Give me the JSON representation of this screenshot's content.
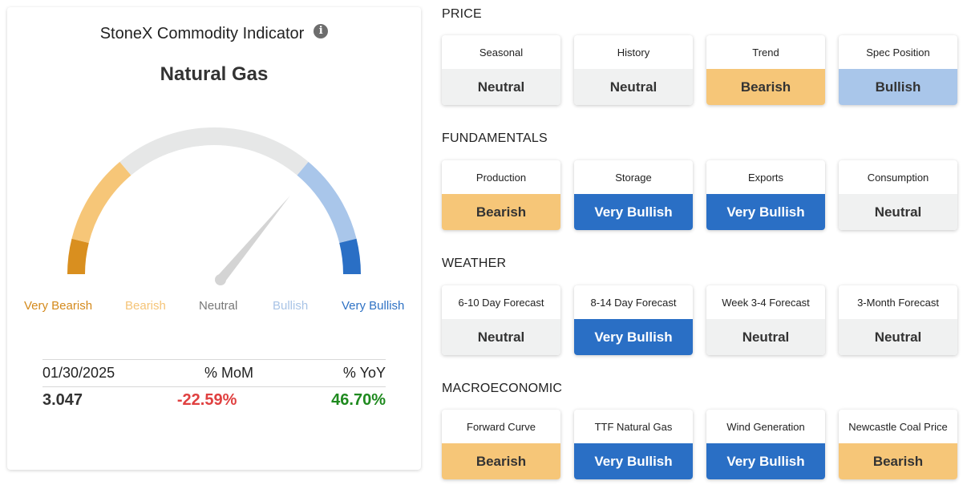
{
  "indicator": {
    "title": "StoneX Commodity Indicator",
    "info_icon": "info-icon",
    "commodity": "Natural Gas",
    "gauge_level": 0.72,
    "gauge_colors": {
      "very_bearish": "#d98f1f",
      "bearish": "#f6c678",
      "neutral": "#e6e7e7",
      "bullish": "#a9c6ea",
      "very_bullish": "#2a6fc5"
    },
    "scale_labels": [
      "Very Bearish",
      "Bearish",
      "Neutral",
      "Bullish",
      "Very Bullish"
    ],
    "stats": {
      "date": "01/30/2025",
      "mom_header": "% MoM",
      "yoy_header": "% YoY",
      "price": "3.047",
      "mom": "-22.59%",
      "yoy": "46.70%"
    }
  },
  "sections": [
    {
      "title": "PRICE",
      "cards": [
        {
          "label": "Seasonal",
          "value": "Neutral",
          "status": "neutral"
        },
        {
          "label": "History",
          "value": "Neutral",
          "status": "neutral"
        },
        {
          "label": "Trend",
          "value": "Bearish",
          "status": "bearish"
        },
        {
          "label": "Spec Position",
          "value": "Bullish",
          "status": "bullish"
        }
      ]
    },
    {
      "title": "FUNDAMENTALS",
      "cards": [
        {
          "label": "Production",
          "value": "Bearish",
          "status": "bearish"
        },
        {
          "label": "Storage",
          "value": "Very Bullish",
          "status": "verybullish"
        },
        {
          "label": "Exports",
          "value": "Very Bullish",
          "status": "verybullish"
        },
        {
          "label": "Consumption",
          "value": "Neutral",
          "status": "neutral"
        }
      ]
    },
    {
      "title": "WEATHER",
      "cards": [
        {
          "label": "6-10 Day Forecast",
          "value": "Neutral",
          "status": "neutral"
        },
        {
          "label": "8-14 Day Forecast",
          "value": "Very Bullish",
          "status": "verybullish"
        },
        {
          "label": "Week 3-4 Forecast",
          "value": "Neutral",
          "status": "neutral"
        },
        {
          "label": "3-Month Forecast",
          "value": "Neutral",
          "status": "neutral"
        }
      ]
    },
    {
      "title": "MACROECONOMIC",
      "cards": [
        {
          "label": "Forward Curve",
          "value": "Bearish",
          "status": "bearish"
        },
        {
          "label": "TTF Natural Gas",
          "value": "Very Bullish",
          "status": "verybullish"
        },
        {
          "label": "Wind Generation",
          "value": "Very Bullish",
          "status": "verybullish"
        },
        {
          "label": "Newcastle Coal Price",
          "value": "Bearish",
          "status": "bearish"
        }
      ]
    }
  ]
}
